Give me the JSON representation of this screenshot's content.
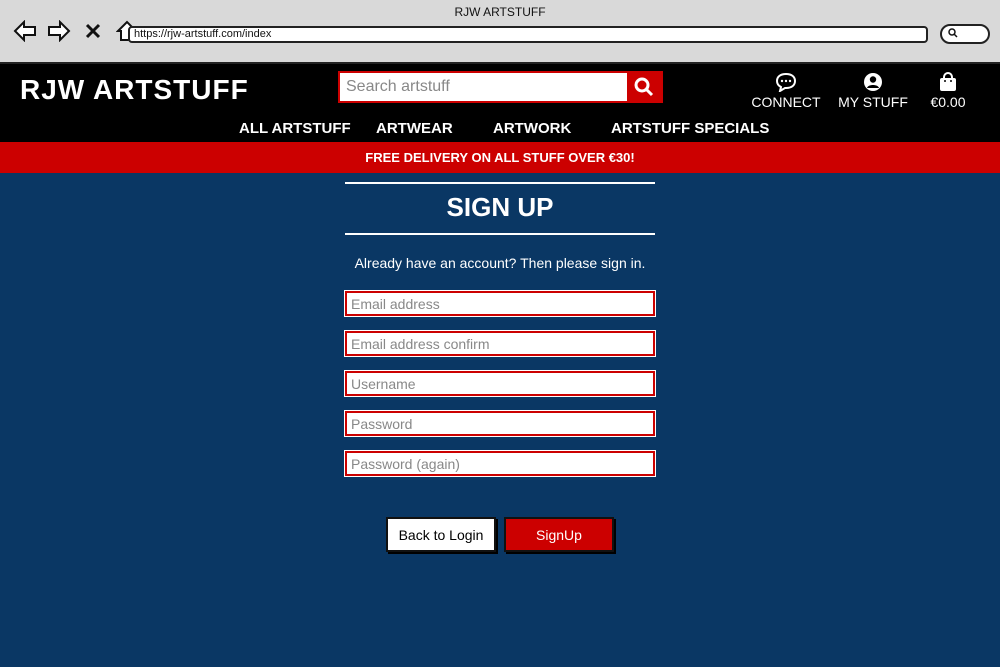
{
  "browser": {
    "title": "RJW ARTSTUFF",
    "url": "https://rjw-artstuff.com/index"
  },
  "site": {
    "logo": "RJW ARTSTUFF",
    "search_placeholder": "Search artstuff",
    "connect_label": "CONNECT",
    "mystuff_label": "MY STUFF",
    "cart_total": "€0.00"
  },
  "menu": [
    "ALL ARTSTUFF",
    "ARTWEAR",
    "ARTWORK",
    "ARTSTUFF SPECIALS"
  ],
  "banner": "FREE DELIVERY ON ALL STUFF OVER €30!",
  "form": {
    "title": "SIGN UP",
    "subtitle": "Already have an account? Then please sign in.",
    "email_placeholder": "Email address",
    "email_confirm_placeholder": "Email address confirm",
    "username_placeholder": "Username",
    "password_placeholder": "Password",
    "password_again_placeholder": "Password (again)",
    "back_label": "Back to Login",
    "signup_label": "SignUp"
  },
  "colors": {
    "accent": "#cc0000",
    "background": "#0a3764",
    "header": "#000000"
  }
}
